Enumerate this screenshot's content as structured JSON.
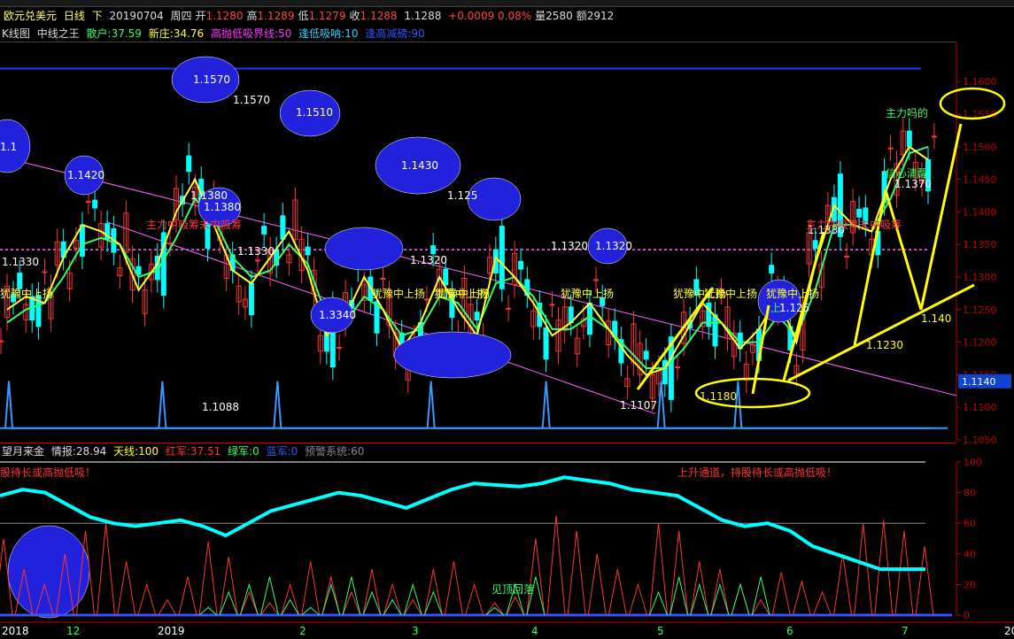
{
  "header": {
    "symbol": "欧元兑美元",
    "period": "日线",
    "dir": "下",
    "date": "20190704",
    "weekday": "周四",
    "open_label": "开",
    "open": "1.1280",
    "high_label": "高",
    "high": "1.1289",
    "low_label": "低",
    "low": "1.1279",
    "close_label": "收",
    "close": "1.1288",
    "last": "1.1288",
    "change": "+0.0009 0.08%",
    "vol_label": "量",
    "vol": "2580",
    "amt_label": "额",
    "amt": "2912"
  },
  "indicators_top": {
    "k_label": "K线图",
    "name": "中线之王",
    "sanhu": "散户:37.59",
    "xinzhuang": "新庄:34.76",
    "gaopao": "高抛低吸界线:50",
    "fengdi": "逢低吸呐:10",
    "fenggao": "逢高减磅:90"
  },
  "indicators_bottom": {
    "name": "望月来金",
    "qingbao": "情报:28.94",
    "tianxian": "天线:100",
    "hongjun": "红军:37.51",
    "lvjun": "绿军:0",
    "lanjun": "蓝军:0",
    "yujing": "预警系统:60"
  },
  "colors": {
    "up": "#ff3333",
    "down": "#00ffff",
    "ma1": "#ffff33",
    "ma2": "#33ff66",
    "axis": "#c00000",
    "hline": "#2233ff",
    "channel": "#ff66ff",
    "arrow": "#ffff00",
    "ellipse": "#2222dd"
  },
  "chart_data": [
    {
      "type": "candlestick",
      "title": "欧元兑美元 日线",
      "ylim": [
        1.105,
        1.166
      ],
      "yticks": [
        "1.1600",
        "1.1550",
        "1.1500",
        "1.1450",
        "1.1400",
        "1.1350",
        "1.1300",
        "1.1250",
        "1.1200",
        "1.1150",
        "1.1100",
        "1.1050"
      ],
      "last_price_label": "1.1140",
      "xticks": [
        "2018",
        "12",
        "2019",
        "2",
        "3",
        "4",
        "5",
        "6",
        "7",
        "20"
      ],
      "price_labels": [
        "1.1570",
        "1.1570",
        "1.1510",
        "1.1430",
        "1.1420",
        "1.1380",
        "1.1380",
        "1.1330",
        "1.1330",
        "1.1320",
        "1.1320",
        "1.1320",
        "1.1330",
        "1.1370",
        "1.140",
        "1.1230",
        "1.1180",
        "1.1107",
        "1.1088",
        "1.3340",
        "1.125",
        "1.125",
        "1.1"
      ],
      "texts": [
        "犹豫中上扬",
        "犹豫中上扬",
        "犹豫中上扬",
        "犹豫中上扬",
        "犹豫中上扬",
        "犹豫中上扬",
        "犹豫中上扬",
        "犹豫中上扬",
        "主力中吸筹未中吸筹",
        "主力中吸筹未中吸筹",
        "信心清醒",
        "主力吗的",
        "上"
      ],
      "ma_fast": [
        1.125,
        1.127,
        1.126,
        1.133,
        1.138,
        1.137,
        1.135,
        1.128,
        1.132,
        1.14,
        1.145,
        1.138,
        1.131,
        1.129,
        1.133,
        1.137,
        1.131,
        1.121,
        1.124,
        1.13,
        1.125,
        1.119,
        1.123,
        1.13,
        1.125,
        1.121,
        1.133,
        1.13,
        1.126,
        1.121,
        1.123,
        1.126,
        1.122,
        1.118,
        1.115,
        1.116,
        1.121,
        1.126,
        1.123,
        1.119,
        1.122,
        1.127,
        1.12,
        1.132,
        1.141,
        1.138,
        1.137,
        1.145,
        1.15,
        1.148
      ],
      "ma_slow": [
        1.123,
        1.125,
        1.126,
        1.13,
        1.135,
        1.136,
        1.135,
        1.13,
        1.131,
        1.136,
        1.142,
        1.139,
        1.133,
        1.13,
        1.131,
        1.135,
        1.132,
        1.124,
        1.123,
        1.127,
        1.125,
        1.121,
        1.122,
        1.127,
        1.126,
        1.122,
        1.129,
        1.13,
        1.127,
        1.122,
        1.122,
        1.124,
        1.122,
        1.119,
        1.116,
        1.116,
        1.119,
        1.123,
        1.123,
        1.12,
        1.12,
        1.124,
        1.121,
        1.128,
        1.138,
        1.138,
        1.137,
        1.142,
        1.149,
        1.15
      ],
      "signals": [
        1.114,
        1.107,
        1.107,
        1.107,
        1.114,
        1.107,
        1.107,
        1.114,
        1.107,
        1.107,
        1.107,
        1.114,
        1.107,
        1.107,
        1.114,
        1.107,
        1.107,
        1.114,
        1.107,
        1.114,
        1.107,
        1.107,
        1.107,
        1.107,
        1.107
      ],
      "upper_line": 1.162
    },
    {
      "type": "bar",
      "title": "望月来金",
      "ylim": [
        0,
        100
      ],
      "yticks": [
        "100",
        "80",
        "60",
        "40",
        "20",
        "0"
      ],
      "texts": [
        "股待长或高抛低吸！",
        "上升通道，持股待长或高抛低吸！",
        "见顶回落"
      ],
      "red_bars": [
        50,
        30,
        20,
        40,
        55,
        60,
        35,
        20,
        10,
        25,
        48,
        38,
        15,
        8,
        20,
        35,
        25,
        15,
        30,
        20,
        10,
        30,
        35,
        20,
        8,
        12,
        50,
        65,
        55,
        40,
        30,
        20,
        60,
        55,
        35,
        30,
        20,
        10,
        28,
        22,
        15,
        40,
        60,
        62,
        55,
        45
      ],
      "green_bars": [
        0,
        0,
        0,
        0,
        0,
        0,
        0,
        0,
        0,
        0,
        5,
        15,
        20,
        25,
        10,
        5,
        20,
        25,
        15,
        10,
        20,
        15,
        0,
        0,
        5,
        20,
        25,
        0,
        0,
        0,
        0,
        0,
        15,
        25,
        20,
        20,
        20,
        25,
        0,
        0,
        0,
        0,
        0,
        0,
        0,
        0
      ],
      "line": [
        78,
        82,
        80,
        72,
        64,
        60,
        58,
        60,
        62,
        58,
        52,
        60,
        68,
        72,
        76,
        80,
        78,
        74,
        70,
        76,
        82,
        86,
        85,
        84,
        86,
        90,
        88,
        86,
        82,
        80,
        78,
        70,
        62,
        58,
        60,
        55,
        45,
        40,
        35,
        30,
        30,
        30
      ]
    }
  ]
}
